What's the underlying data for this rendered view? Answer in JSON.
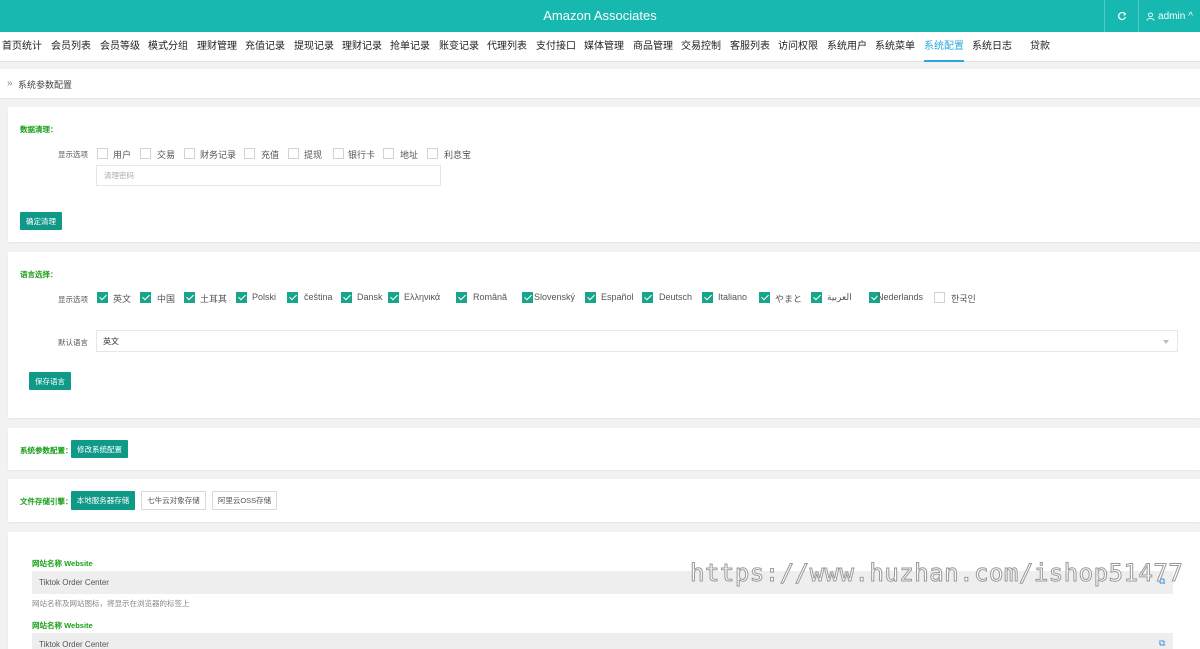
{
  "header": {
    "title": "Amazon Associates",
    "refresh_icon": "refresh-icon",
    "user_icon": "user-icon",
    "user_name": "admin",
    "user_caret": "^"
  },
  "nav": {
    "items": [
      "首页统计",
      "会员列表",
      "会员等级",
      "模式分组",
      "理财管理",
      "充值记录",
      "提现记录",
      "理财记录",
      "抢单记录",
      "账变记录",
      "代理列表",
      "支付接口",
      "媒体管理",
      "商品管理",
      "交易控制",
      "客服列表",
      "访问权限",
      "系统用户",
      "系统菜单",
      "系统配置",
      "系统日志",
      "贷款"
    ],
    "active_index": 19
  },
  "breadcrumb": {
    "arrow": "»",
    "text": "系统参数配置"
  },
  "data_clear": {
    "title": "数据清理：",
    "options_label": "显示选项",
    "options": [
      "用户",
      "交易",
      "财务记录",
      "充值",
      "提现",
      "银行卡",
      "地址",
      "利息宝"
    ],
    "password_placeholder": "清理密码",
    "confirm_button": "确定清理"
  },
  "language": {
    "title": "语言选择：",
    "options_label": "显示选项",
    "options": [
      "英文",
      "中国",
      "土耳其",
      "Polski",
      "čeština",
      "Dansk",
      "Ελληνικά",
      "Română",
      "Slovenský",
      "Español",
      "Deutsch",
      "Italiano",
      "やまと",
      "العربية",
      "Nederlands",
      "한국인"
    ],
    "checked": [
      true,
      true,
      true,
      true,
      true,
      true,
      true,
      true,
      true,
      true,
      true,
      true,
      true,
      true,
      true,
      false
    ],
    "default_label": "默认语言",
    "default_value": "英文",
    "save_button": "保存语言"
  },
  "sys_params": {
    "title": "系统参数配置：",
    "button": "修改系统配置"
  },
  "storage": {
    "title": "文件存储引擎：",
    "options": [
      "本地服务器存储",
      "七牛云对象存储",
      "阿里云OSS存储"
    ],
    "active_index": 0
  },
  "site": {
    "fields": [
      {
        "label": "网站名称 Website",
        "value": "Tiktok  Order Center",
        "hint": "网站名称及网站图标，将显示在浏览器的标签上"
      },
      {
        "label": "网站名称 Website",
        "value": "Tiktok  Order Center",
        "hint": ""
      }
    ],
    "copy_icon": "copy-icon"
  },
  "watermark": "https://www.huzhan.com/ishop51477",
  "colors": {
    "accent": "#16b8b0",
    "button": "#0f9a87",
    "checked": "#18a589",
    "section_title": "#1aa01a",
    "active_nav": "#29a8e0"
  }
}
